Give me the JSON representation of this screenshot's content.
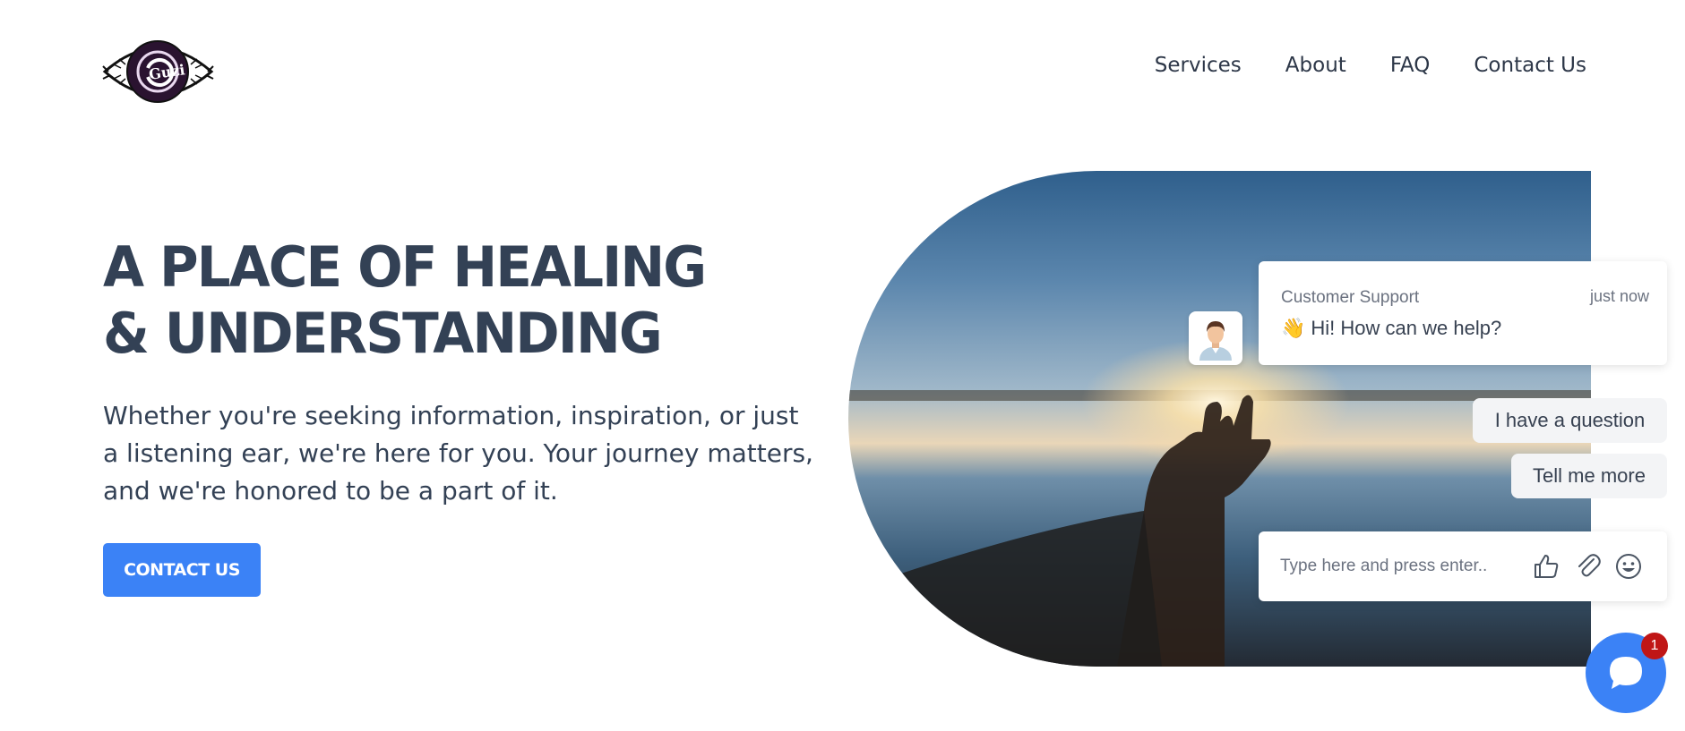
{
  "header": {
    "logo_text": "Guzi",
    "nav": [
      {
        "label": "Services"
      },
      {
        "label": "About"
      },
      {
        "label": "FAQ"
      },
      {
        "label": "Contact Us"
      }
    ]
  },
  "hero": {
    "title": "A Place of Healing & Understanding",
    "subtitle": "Whether you're seeking information, inspiration, or just a listening ear, we're here for you. Your journey matters, and we're honored to be a part of it.",
    "cta_label": "Contact Us"
  },
  "chat": {
    "sender": "Customer Support",
    "time": "just now",
    "message": "Hi! How can we help?",
    "message_emoji": "👋",
    "quick_replies": [
      "I have a question",
      "Tell me more"
    ],
    "input_placeholder": "Type here and press enter..",
    "unread_count": "1",
    "accent_color": "#3b82f6",
    "badge_color": "#c01616"
  }
}
